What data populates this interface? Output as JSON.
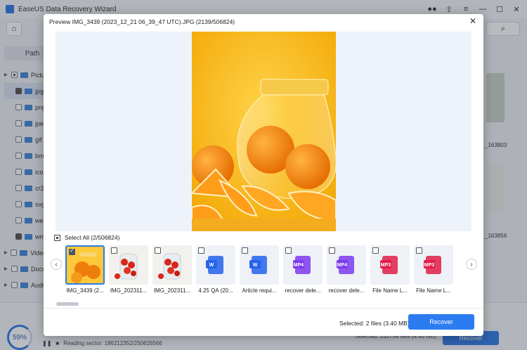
{
  "app": {
    "title": "EaseUS Data Recovery Wizard",
    "path_tab": "Path",
    "tree": [
      {
        "label": "Pictu",
        "level": 0
      },
      {
        "label": "jpg",
        "level": 1
      },
      {
        "label": "png",
        "level": 1
      },
      {
        "label": "jpeg",
        "level": 1
      },
      {
        "label": "gif",
        "level": 1
      },
      {
        "label": "bmp",
        "level": 1
      },
      {
        "label": "ico",
        "level": 1
      },
      {
        "label": "cr2",
        "level": 1
      },
      {
        "label": "svg",
        "level": 1
      },
      {
        "label": "web",
        "level": 1
      },
      {
        "label": "wm",
        "level": 1
      },
      {
        "label": "Video",
        "level": 0
      },
      {
        "label": "Docu",
        "level": 0
      },
      {
        "label": "Audi",
        "level": 0
      }
    ],
    "right_labels": [
      "_163803",
      "_163856"
    ],
    "progress": "59%",
    "scan_status": "Reading sector: 186212352/250626566",
    "bg_status": "Selected: 132754 files (4.40 GB)",
    "bg_recover": "Recover",
    "bottom_left_label": "A"
  },
  "modal": {
    "title": "Preview IMG_3439 (2023_12_21 06_39_47 UTC).JPG (2139/506824)",
    "select_all": "Select All (2/506824)",
    "selected_info": "Selected: 2 files (3.40 MB)",
    "recover_label": "Recover",
    "thumbnails": [
      {
        "label": "IMG_3439 (2...",
        "type": "image-oranges",
        "checked": true
      },
      {
        "label": "IMG_202311...",
        "type": "image-tomatoes",
        "checked": false
      },
      {
        "label": "IMG_202311...",
        "type": "image-tomatoes",
        "checked": false
      },
      {
        "label": "4.25 QA (20...",
        "type": "word",
        "checked": false
      },
      {
        "label": "Article requi...",
        "type": "word",
        "checked": false
      },
      {
        "label": "recover dele...",
        "type": "mp4",
        "checked": false
      },
      {
        "label": "recover dele...",
        "type": "mp4",
        "checked": false
      },
      {
        "label": "File Name L...",
        "type": "mp3",
        "checked": false
      },
      {
        "label": "File Name L...",
        "type": "mp3",
        "checked": false
      }
    ],
    "file_badges": {
      "mp4": "MP4",
      "mp3": "MP3",
      "word": "W"
    }
  },
  "colors": {
    "accent": "#2b7cf0",
    "preview_bg": "#eef2fb",
    "mp4": "#7c3aed",
    "mp3": "#e11d48",
    "word": "#2563eb"
  }
}
